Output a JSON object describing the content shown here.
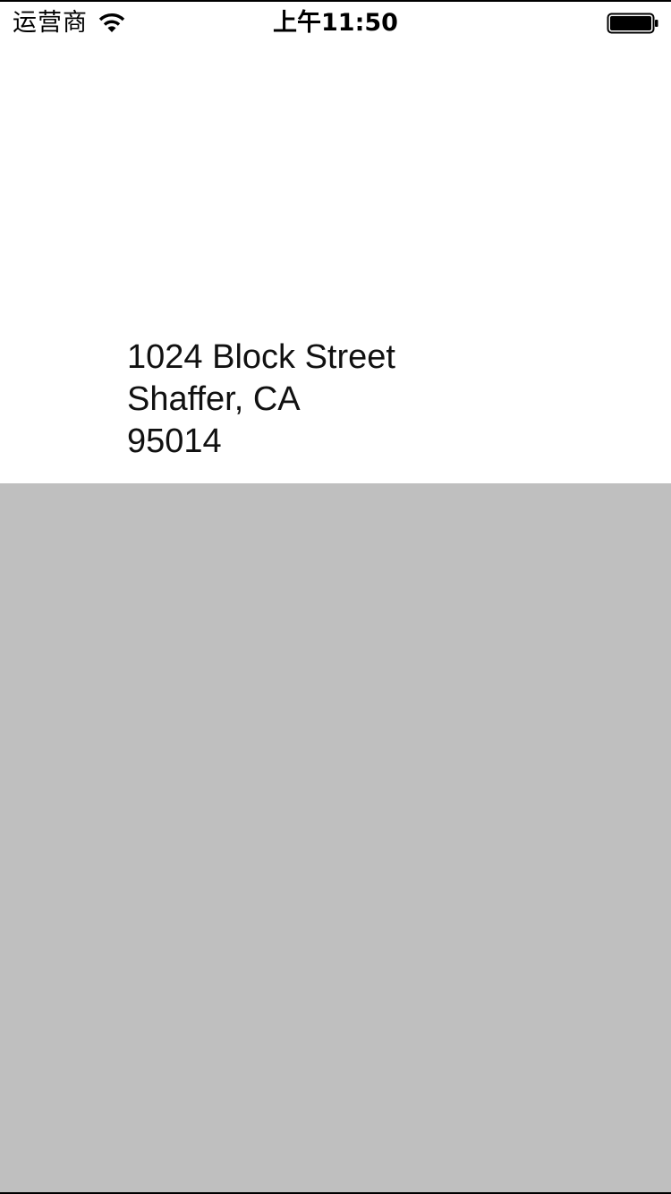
{
  "status_bar": {
    "carrier": "运营商",
    "time": "上午11:50",
    "wifi_icon": "wifi-icon",
    "battery_icon": "battery-icon",
    "battery_level": 1.0
  },
  "address": {
    "line1": "1024 Block Street",
    "line2": "Shaffer, CA",
    "line3": "95014"
  },
  "colors": {
    "background": "#ffffff",
    "panel": "#bfbfbf",
    "text": "#111111"
  }
}
